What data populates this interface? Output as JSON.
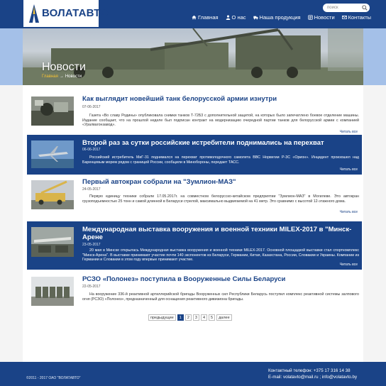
{
  "header": {
    "logo_text": "ВОЛАТАВТО",
    "search_placeholder": "поиск",
    "nav": [
      {
        "label": "Главная",
        "icon": "home-icon"
      },
      {
        "label": "О нас",
        "icon": "user-icon"
      },
      {
        "label": "Наша продукция",
        "icon": "truck-icon"
      },
      {
        "label": "Новости",
        "icon": "news-icon"
      },
      {
        "label": "Контакты",
        "icon": "mail-icon"
      }
    ]
  },
  "hero": {
    "title": "Новости",
    "breadcrumb": {
      "home": "Главная",
      "separator": "→",
      "current": "Новости"
    }
  },
  "articles": [
    {
      "title": "Как выглядит новейший танк белорусской армии изнутри",
      "date": "07-06-2017",
      "text": "Газета «Во славу Родины» опубликовала снимки танков Т-72Б3 с дополнительной защитой, на которых было запечатлено боевое отделение машины. Издание сообщает, что на прошлой неделе был подписан контракт на модернизацию очередной партии танков для белорусской армии с компанией «Уралвагонзавод».",
      "more": "Читать все",
      "style": "light"
    },
    {
      "title": "Второй раз за сутки российские истребители поднимались на перехват",
      "date": "06-06-2017",
      "text": "Российский истребитель МиГ-31 поднимался на перехват противолодочного самолета ВВС Норвегии Р-3С «Орион». Инцидент произошел над Баренцевым морем рядом с границей России, сообщили в Минобороны, передает ТАСС.",
      "more": "Читать все",
      "style": "dark"
    },
    {
      "title": "Первый автокран собрали на \"Зумлион-МАЗ\"",
      "date": "24-05-2017",
      "text": "Первую единицу техники собрали 17.05.2017г. на совместном белорусско-китайском предприятии \"Зумлион-МАЗ\" в Могилеве. Это автокран грузоподъемностью 25 тонн и самой длинной в Беларуси стрелой, максимально выдвигаемой на 41 метр. Это сравнимо с высотой 12-этажного дома.",
      "more": "Читать все",
      "style": "light"
    },
    {
      "title": "Международная выставка вооружения и военной техники MILEX-2017 в \"Минск-Арене",
      "date": "23-05-2017",
      "text": "20 мая в Минске открылась Международная выставка вооружения и военной техники MILEX-2017. Основной площадкой выставки стал спорткомплекс \"Минск-Арена\". В выставке принимают участие почти 140 экспонентов из Беларуси, Германии, Китая, Казахстана, России, Словакии и Украины. Компании из Германии и Словакии в этом году впервые принимают участие.",
      "more": "Читать все",
      "style": "dark"
    },
    {
      "title": "РСЗО «Полонез» поступила в Вооруженные Силы Беларуси",
      "date": "22-05-2017",
      "text": "На вооружение 336-й реактивной артиллерийской бригады Вооруженных сил Республики Беларусь поступил комплекс реактивной системы залпового огня (РСЗО) «Полонез», предназначенный для оснащения реактивного дивизиона бригады.",
      "more": "Читать все",
      "style": "light"
    }
  ],
  "pagination": {
    "prev": "предыдущие",
    "pages": [
      "1",
      "2",
      "3",
      "4",
      "5"
    ],
    "current": "1",
    "next": "далее"
  },
  "footer": {
    "copyright": "©2011 - 2017 ОАО \"ВОЛАТАВТО\"",
    "phone": "Контактный телефон: +375 17 316 14 38",
    "email1": "E-mail: volatavto@mail.ru",
    "email2": "info@volatavto.by"
  },
  "colors": {
    "brand": "#1a4387",
    "accent": "#f7c233",
    "page_bg": "#f4f4f4"
  }
}
